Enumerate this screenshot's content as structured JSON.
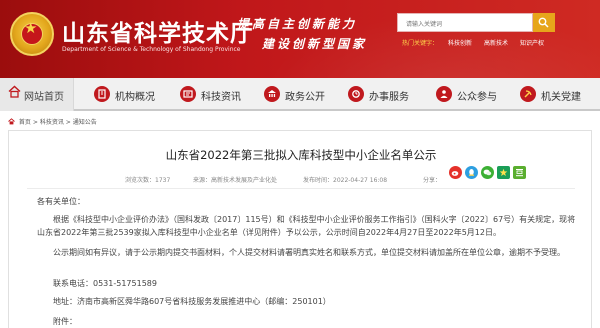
{
  "header": {
    "site_title": "山东省科学技术厅",
    "site_subtitle": "Department of Science & Technology of Shandong Province",
    "slogan_line1": "提高自主创新能力",
    "slogan_line2": "建设创新型国家",
    "search_placeholder": "请输入关键词",
    "hot_label": "热门关键字：",
    "hot_keywords": [
      "科技创新",
      "高新技术",
      "知识产权"
    ],
    "colors": {
      "header_red": "#c0171a",
      "search_button": "#e7a51b",
      "hot_label": "#ffd24a"
    }
  },
  "nav": {
    "items": [
      {
        "label": "网站首页",
        "icon": "home-icon"
      },
      {
        "label": "机构概况",
        "icon": "building-icon"
      },
      {
        "label": "科技资讯",
        "icon": "news-icon"
      },
      {
        "label": "政务公开",
        "icon": "gov-icon"
      },
      {
        "label": "办事服务",
        "icon": "service-icon"
      },
      {
        "label": "公众参与",
        "icon": "people-icon"
      },
      {
        "label": "机关党建",
        "icon": "party-icon"
      }
    ]
  },
  "breadcrumb": {
    "home": "首页",
    "sep": ">",
    "section": "科技资讯",
    "page": "通知公告"
  },
  "article": {
    "title": "山东省2022年第三批拟入库科技型中小企业名单公示",
    "views": "浏览次数：1737",
    "source": "来源：高新技术发展及产业化处",
    "date": "发布时间：2022-04-27 16:08",
    "share_label": "分享：",
    "salutation": "各有关单位：",
    "paragraph1": "根据《科技型中小企业评价办法》（国科发政〔2017〕115号）和《科技型中小企业评价服务工作指引》（国科火字〔2022〕67号）有关规定，现将山东省2022年第三批2539家拟入库科技型中小企业名单（详见附件）予以公示，公示时间自2022年4月27日至2022年5月12日。",
    "paragraph2": "公示期间如有异议，请于公示期内提交书面材料，个人提交材料请署明真实姓名和联系方式，单位提交材料请加盖所在单位公章，逾期不予受理。",
    "phone": "联系电话：0531-51751589",
    "address": "地址：济南市高新区舜华路607号省科技服务发展推进中心（邮编：250101）",
    "attachment": "附件："
  }
}
